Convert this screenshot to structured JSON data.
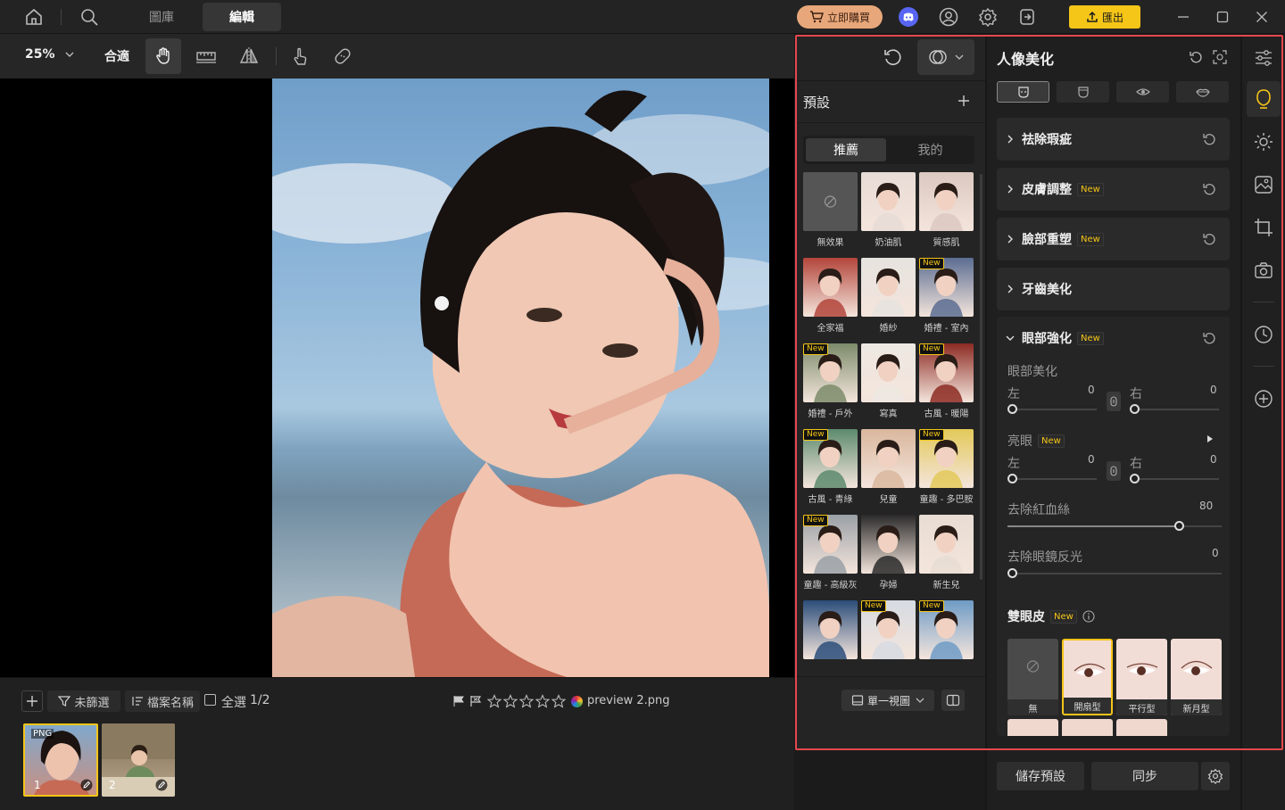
{
  "topbar": {
    "tabs": [
      "圖庫",
      "編輯"
    ],
    "buy_label": "立即購買",
    "export_label": "匯出"
  },
  "toolbar": {
    "zoom": "25%",
    "fit_label": "合適"
  },
  "filmstrip": {
    "filter_label": "未篩選",
    "sort_label": "檔案名稱",
    "select_all_label": "全選",
    "count": "1/2",
    "filename": "preview 2.png",
    "thumbs": [
      {
        "badge": "PNG",
        "index": "1"
      },
      {
        "badge": "",
        "index": "2"
      }
    ]
  },
  "presets": {
    "title": "預設",
    "tabs": [
      "推薦",
      "我的"
    ],
    "items": [
      {
        "label": "無效果",
        "new": "",
        "color": "#555555"
      },
      {
        "label": "奶油肌",
        "new": "",
        "color": "#e8dcd6"
      },
      {
        "label": "質感肌",
        "new": "",
        "color": "#dcc9c1"
      },
      {
        "label": "全家福",
        "new": "",
        "color": "#b3453b"
      },
      {
        "label": "婚紗",
        "new": "",
        "color": "#e6e3df"
      },
      {
        "label": "婚禮 - 室內",
        "new": "New",
        "color": "#5c6d92"
      },
      {
        "label": "婚禮 - 戶外",
        "new": "New",
        "color": "#7c8b6a"
      },
      {
        "label": "寫真",
        "new": "",
        "color": "#ede8e2"
      },
      {
        "label": "古風 - 暖陽",
        "new": "New",
        "color": "#8c2b23"
      },
      {
        "label": "古風 - 青綠",
        "new": "New",
        "color": "#5c8a6d"
      },
      {
        "label": "兒童",
        "new": "",
        "color": "#d9b79d"
      },
      {
        "label": "童趣 - 多巴胺",
        "new": "New",
        "color": "#e3c95a"
      },
      {
        "label": "童趣 - 高級灰",
        "new": "New",
        "color": "#9aa0a6"
      },
      {
        "label": "孕婦",
        "new": "",
        "color": "#2a2a2a"
      },
      {
        "label": "新生兒",
        "new": "",
        "color": "#e8ddd3"
      },
      {
        "label": "",
        "new": "",
        "color": "#2b4d7a"
      },
      {
        "label": "",
        "new": "New",
        "color": "#d6dbe2"
      },
      {
        "label": "",
        "new": "New",
        "color": "#6e9bc6"
      }
    ],
    "view_label": "單一視圖"
  },
  "portrait": {
    "title": "人像美化",
    "sections": [
      {
        "label": "祛除瑕疵",
        "new": ""
      },
      {
        "label": "皮膚調整",
        "new": "New"
      },
      {
        "label": "臉部重塑",
        "new": "New"
      },
      {
        "label": "牙齒美化",
        "new": ""
      }
    ],
    "eye": {
      "label": "眼部強化",
      "new": "New",
      "beautify_label": "眼部美化",
      "left_label": "左",
      "right_label": "右",
      "left_value": "0",
      "right_value": "0",
      "bright_label": "亮眼",
      "bright_new": "New",
      "bright_left_value": "0",
      "bright_right_value": "0",
      "redness_label": "去除紅血絲",
      "redness_value": "80",
      "glare_label": "去除眼鏡反光",
      "glare_value": "0"
    },
    "eyelid": {
      "label": "雙眼皮",
      "new": "New",
      "options": [
        "無",
        "開扇型",
        "平行型",
        "新月型"
      ]
    }
  },
  "bottom": {
    "save_preset_label": "儲存預設",
    "sync_label": "同步"
  },
  "colors": {
    "accent": "#f5c518",
    "highlight": "#e5484d",
    "buy_bg": "#e8a77a"
  }
}
